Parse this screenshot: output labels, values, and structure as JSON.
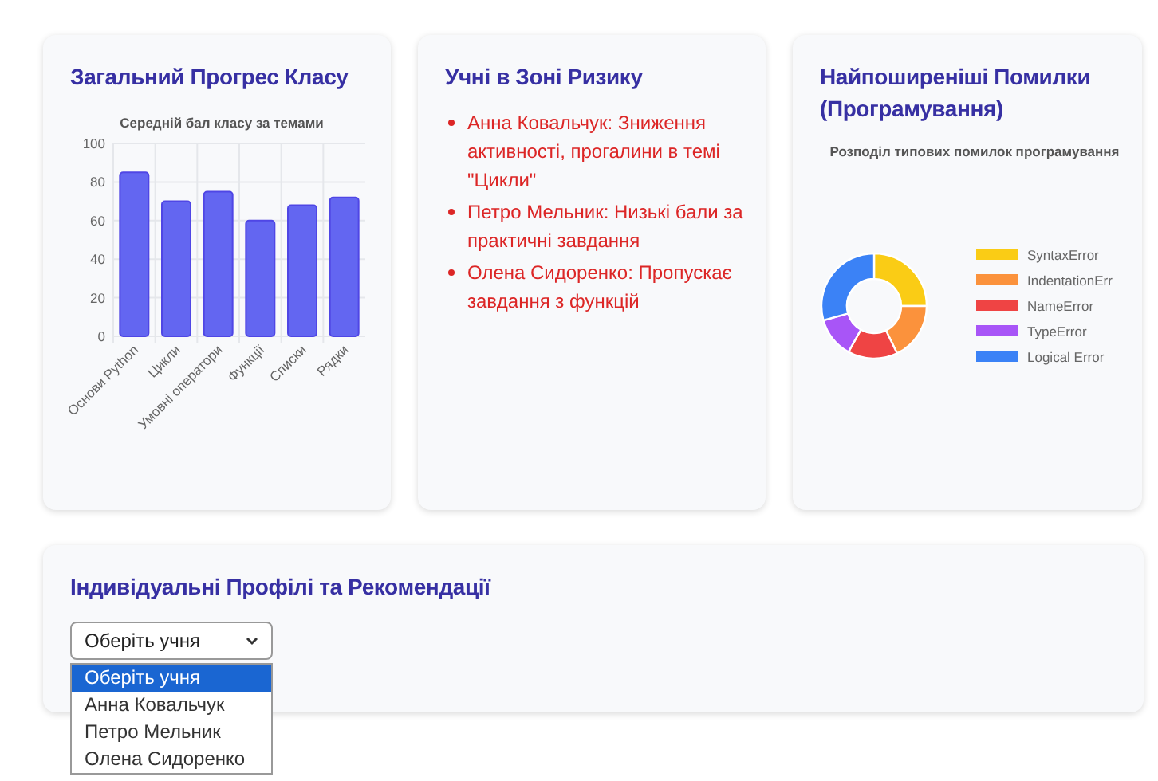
{
  "progress_card": {
    "title": "Загальний Прогрес Класу",
    "chart_data": {
      "type": "bar",
      "title": "Середній бал класу за темами",
      "categories": [
        "Основи Python",
        "Цикли",
        "Умовні оператори",
        "Функції",
        "Списки",
        "Рядки"
      ],
      "values": [
        85,
        70,
        75,
        60,
        68,
        72
      ],
      "ylim": [
        0,
        100
      ],
      "yticks": [
        0,
        20,
        40,
        60,
        80,
        100
      ],
      "grid": true
    }
  },
  "risk_card": {
    "title": "Учні в Зоні Ризику",
    "items": [
      {
        "text": "Анна Ковальчук: Зниження активності, прогалини в темі \"Цикли\""
      },
      {
        "text": "Петро Мельник: Низькі бали за практичні завдання"
      },
      {
        "text": "Олена Сидоренко: Пропускає завдання з функцій"
      }
    ]
  },
  "errors_card": {
    "title": "Найпоширеніші Помилки (Програмування)",
    "chart_title": "Розподіл типових помилок програмування",
    "legend": [
      {
        "label": "SyntaxError",
        "color": "#facc15"
      },
      {
        "label": "IndentationErr",
        "color": "#fb923c"
      },
      {
        "label": "NameError",
        "color": "#ef4444"
      },
      {
        "label": "TypeError",
        "color": "#a855f7"
      },
      {
        "label": "Logical Error",
        "color": "#3b82f6"
      }
    ]
  },
  "profiles_card": {
    "title": "Індивідуальні Профілі та Рекомендації",
    "select": {
      "value": "Оберіть учня",
      "expanded": true,
      "options": [
        {
          "label": "Оберіть учня",
          "selected": true
        },
        {
          "label": "Анна Ковальчук",
          "selected": false
        },
        {
          "label": "Петро Мельник",
          "selected": false
        },
        {
          "label": "Олена Сидоренко",
          "selected": false
        }
      ]
    }
  }
}
